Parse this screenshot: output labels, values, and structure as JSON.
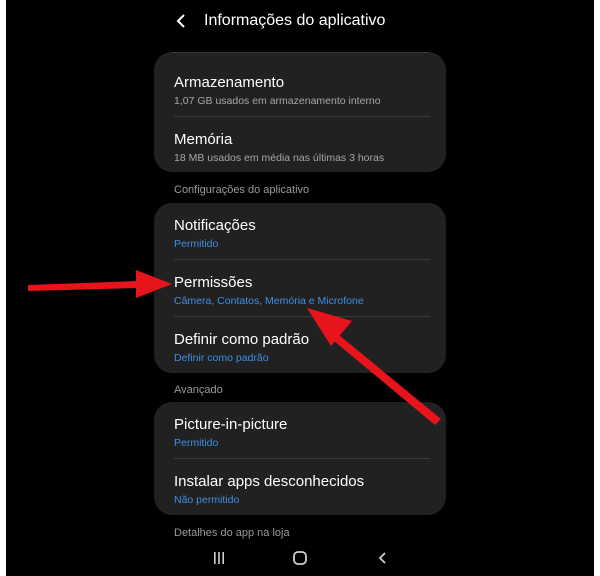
{
  "header": {
    "title": "Informações do aplicativo"
  },
  "storage_card": {
    "items": [
      {
        "title": "Armazenamento",
        "subtitle": "1,07 GB usados em armazenamento interno"
      },
      {
        "title": "Memória",
        "subtitle": "18 MB usados em média nas últimas 3 horas"
      }
    ]
  },
  "sections": {
    "config": "Configurações do aplicativo",
    "advanced": "Avançado",
    "store": "Detalhes do app na loja"
  },
  "config_card": {
    "items": [
      {
        "title": "Notificações",
        "subtitle": "Permitido"
      },
      {
        "title": "Permissões",
        "subtitle": "Câmera, Contatos, Memória e Microfone"
      },
      {
        "title": "Definir como padrão",
        "subtitle": "Definir como padrão"
      }
    ]
  },
  "advanced_card": {
    "items": [
      {
        "title": "Picture-in-picture",
        "subtitle": "Permitido"
      },
      {
        "title": "Instalar apps desconhecidos",
        "subtitle": "Não permitido"
      }
    ]
  },
  "icons": {
    "back": "back-arrow-icon",
    "recents": "recent-apps-icon",
    "home": "home-icon",
    "nav_back": "nav-back-icon"
  },
  "colors": {
    "background": "#000000",
    "card": "#212121",
    "accent_blue": "#3e8fe6",
    "annotation_red": "#e8141b"
  }
}
